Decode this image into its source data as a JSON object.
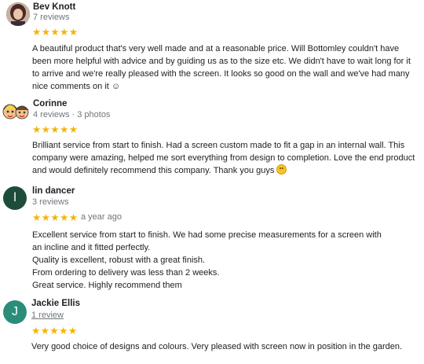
{
  "reviews": [
    {
      "name": "Bev Knott",
      "meta": "7 reviews",
      "stars": "★★★★★",
      "time": "",
      "text": [
        "A beautiful product that's very well made and at a reasonable price. Will Bottomley couldn't have been more helpful with advice and by guiding us as to the size etc. We didn't have to wait long for it to arrive and we're really pleased with the screen. It looks so good on the wall and we've had many nice comments on it ☺"
      ]
    },
    {
      "name": "Corinne",
      "meta": "4 reviews · 3 photos",
      "stars": "★★★★★",
      "time": "",
      "text": [
        "Brilliant service from start to finish. Had a screen custom made to fit a gap in an internal wall. This company were amazing, helped me sort everything from design to completion. Love the end product and would definitely recommend this company. Thank you guys"
      ]
    },
    {
      "name": "lin dancer",
      "meta": "3 reviews",
      "stars": "★★★★★",
      "time": "a year ago",
      "avatar_letter": "l",
      "avatar_color": "#1d4d3a",
      "text": [
        "Excellent service from start to finish.  We had some precise measurements for a screen with an incline and it fitted perfectly.",
        "Quality is excellent, robust with a great finish.",
        "From ordering to delivery was less than 2 weeks.",
        "Great service.  Highly recommend them"
      ]
    },
    {
      "name": "Jackie Ellis",
      "meta": "1 review",
      "stars": "★★★★★",
      "time": "",
      "avatar_letter": "J",
      "avatar_color": "#2a8d7a",
      "text": [
        "Very good choice of designs and colours. Very pleased with screen now in position in the garden."
      ]
    }
  ],
  "colors": {
    "star": "#f4b400",
    "meta": "#70757a",
    "text": "#202124"
  }
}
